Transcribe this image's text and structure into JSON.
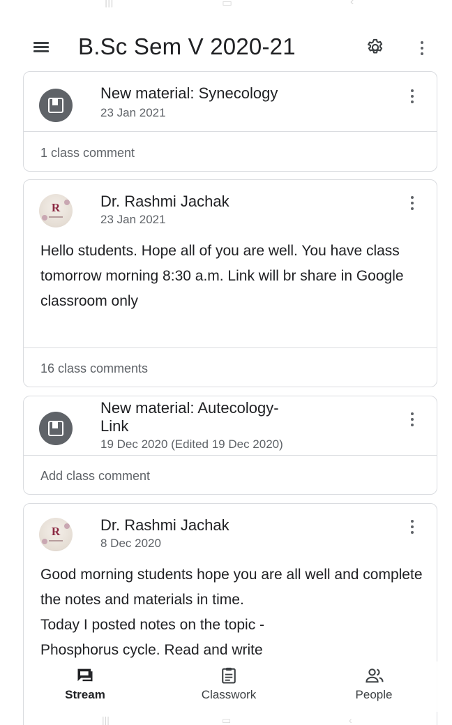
{
  "app_bar": {
    "title": "B.Sc Sem V 2020-21",
    "menu_icon": "hamburger-menu-icon",
    "settings_icon": "gear-icon",
    "overflow_icon": "more-vert-icon"
  },
  "stream": [
    {
      "kind": "material",
      "icon": "material-icon",
      "title": "New material: Synecology",
      "date": "23 Jan 2021",
      "footer": "1 class comment"
    },
    {
      "kind": "announcement",
      "author": "Dr. Rashmi Jachak",
      "avatar_letter": "R",
      "date": "23 Jan 2021",
      "body": "Hello students.  Hope all of you are well. You have class tomorrow morning 8:30 a.m. Link will br share in Google classroom only",
      "footer": "16 class comments"
    },
    {
      "kind": "material",
      "icon": "material-icon",
      "title": "New material: Autecology-Link",
      "title_line1": "New material: Autecology-",
      "title_line2": "Link",
      "date": "19 Dec 2020 (Edited 19 Dec 2020)",
      "footer": "Add class comment"
    },
    {
      "kind": "announcement",
      "author": "Dr. Rashmi Jachak",
      "avatar_letter": "R",
      "date": "8 Dec 2020",
      "body_line1": "Good morning students hope you are all well and complete the notes and materials in time.",
      "body_line2": "Today I posted notes on the topic -",
      "body_line3": "Phosphorus cycle. Read and write"
    }
  ],
  "bottom_nav": [
    {
      "label": "Stream",
      "icon": "stream-icon",
      "active": true
    },
    {
      "label": "Classwork",
      "icon": "classwork-icon",
      "active": false
    },
    {
      "label": "People",
      "icon": "people-icon",
      "active": false
    }
  ],
  "colors": {
    "text_primary": "#202124",
    "text_secondary": "#5f6368",
    "border": "#dadce0",
    "icon_grey": "#5f6368"
  }
}
